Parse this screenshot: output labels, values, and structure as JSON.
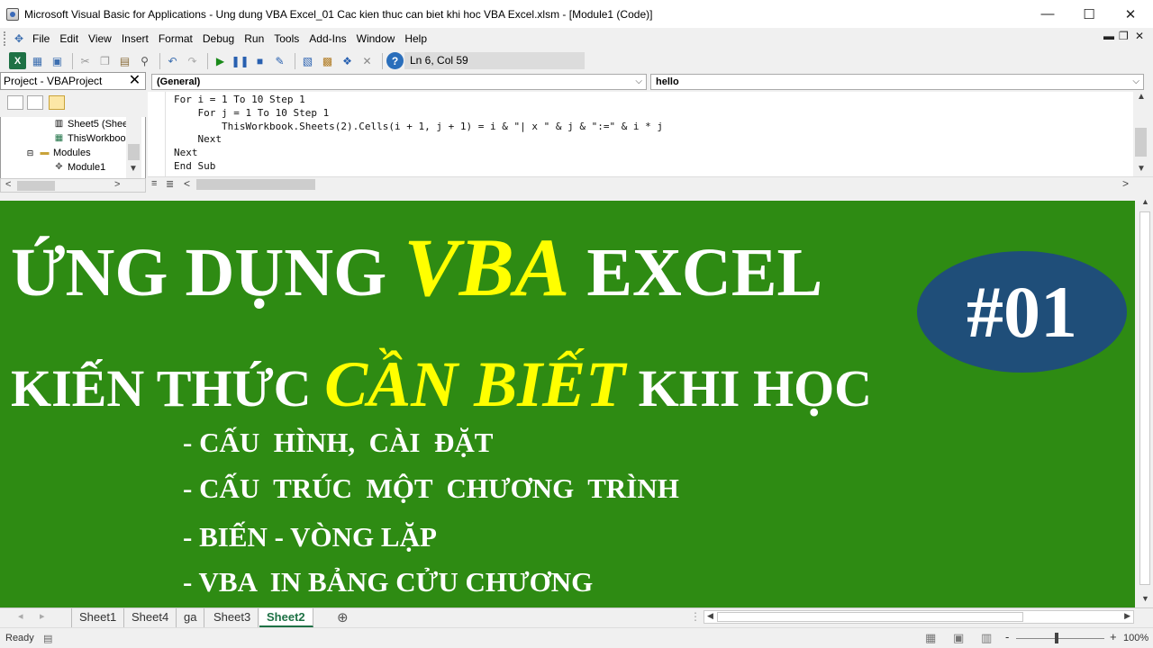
{
  "window": {
    "title": "Microsoft Visual Basic for Applications - Ung dung VBA Excel_01 Cac kien thuc can biet khi hoc VBA Excel.xlsm - [Module1 (Code)]",
    "minimize": "—",
    "maximize": "☐",
    "close": "✕"
  },
  "menu": {
    "items": [
      "File",
      "Edit",
      "View",
      "Insert",
      "Format",
      "Debug",
      "Run",
      "Tools",
      "Add-Ins",
      "Window",
      "Help"
    ],
    "doc_min": "▬",
    "doc_restore": "❐",
    "doc_close": "✕"
  },
  "toolbar": {
    "position": "Ln 6, Col 59"
  },
  "project": {
    "title": "Project - VBAProject",
    "close": "✕",
    "tree": [
      {
        "label": "Sheet5 (Shee",
        "icon": "sheet-icon"
      },
      {
        "label": "ThisWorkboo",
        "icon": "workbook-icon"
      },
      {
        "label": "Modules",
        "icon": "folder-icon"
      },
      {
        "label": "Module1",
        "icon": "module-icon"
      }
    ]
  },
  "code": {
    "object_combo": "(General)",
    "proc_combo": "hello",
    "lines": [
      "For i = 1 To 10 Step 1",
      "    For j = 1 To 10 Step 1",
      "        ThisWorkbook.Sheets(2).Cells(i + 1, j + 1) = i & \"| x \" & j & \":=\" & i * j",
      "    Next",
      "Next",
      "End Sub"
    ]
  },
  "sheet": {
    "heading1_part1": "ỨNG DỤNG",
    "heading1_highlight": "VBA",
    "heading1_part2": "EXCEL",
    "badge": "#01",
    "heading2_part1": "KIẾN THỨC",
    "heading2_highlight": "CẦN BIẾT",
    "heading2_part2": "KHI HỌC",
    "bullets": [
      "- CẤU  HÌNH,  CÀI  ĐẶT",
      "- CẤU  TRÚC  MỘT  CHƯƠNG  TRÌNH",
      "- BIẾN - VÒNG LẶP",
      "- VBA  IN BẢNG CỬU CHƯƠNG"
    ],
    "colors": {
      "background": "#2e8b13",
      "highlight": "#ffff00",
      "badge": "#1f4e79"
    }
  },
  "tabs": {
    "items": [
      "Sheet1",
      "Sheet4",
      "ga",
      "Sheet3",
      "Sheet2"
    ],
    "active": "Sheet2",
    "add": "⊕"
  },
  "status": {
    "ready": "Ready",
    "zoom_minus": "-",
    "zoom_plus": "+",
    "zoom": "100%"
  }
}
